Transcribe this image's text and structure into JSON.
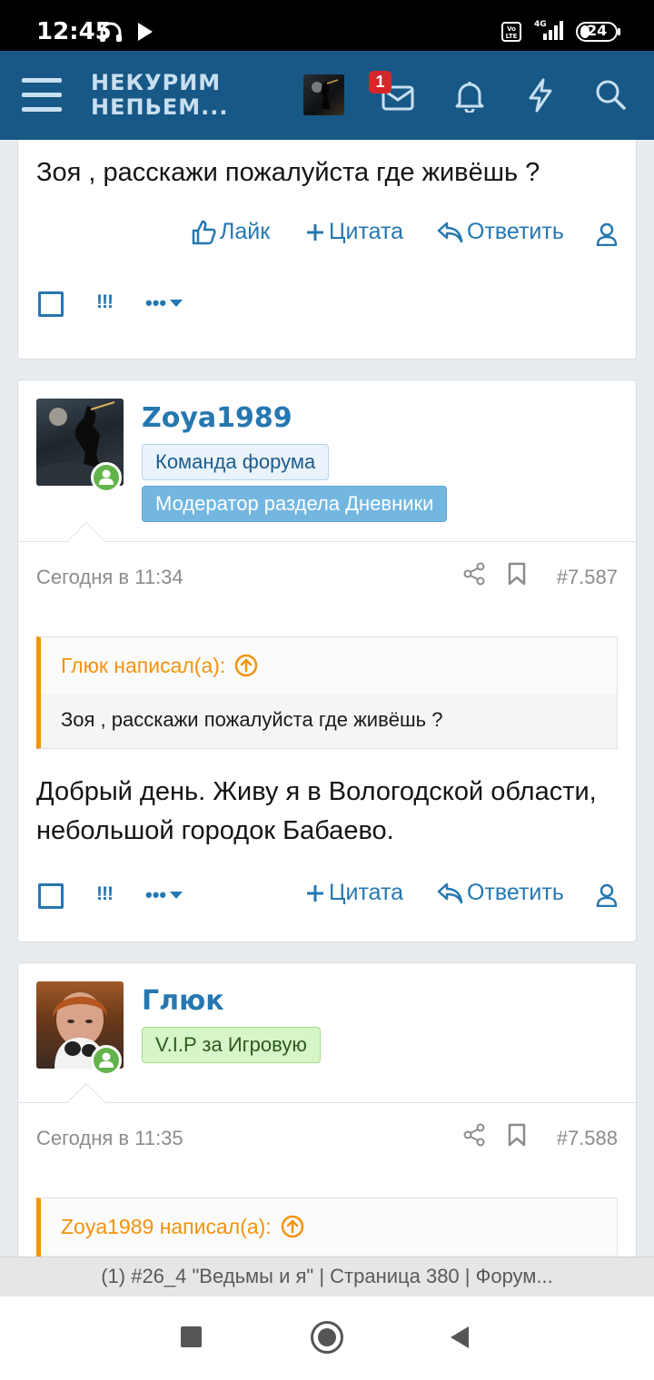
{
  "status_bar": {
    "time": "12:45",
    "battery": "24",
    "network": "4G"
  },
  "header": {
    "logo_line1": "НЕКУРИМ",
    "logo_line2": "НЕПЬЕМ...",
    "notification_count": "1"
  },
  "post_top": {
    "text": "Зоя , расскажи пожалуйста где живёшь ?",
    "like_label": "Лайк",
    "quote_label": "Цитата",
    "reply_label": "Ответить",
    "excl": "!!!"
  },
  "post_zoya": {
    "username": "Zoya1989",
    "tags": [
      "Команда форума",
      "Модератор раздела Дневники"
    ],
    "date": "Сегодня в 11:34",
    "number": "#7.587",
    "quote_author": "Глюк написал(а):",
    "quote_text": "Зоя , расскажи пожалуйста где живёшь ?",
    "text": "Добрый день. Живу я в Вологодской области, небольшой городок Бабаево.",
    "quote_label": "Цитата",
    "reply_label": "Ответить",
    "excl": "!!!"
  },
  "post_gluk": {
    "username": "Глюк",
    "tag": "V.I.P за Игровую",
    "date": "Сегодня в 11:35",
    "number": "#7.588",
    "quote_author": "Zoya1989 написал(а):"
  },
  "url_bar": {
    "text": "(1) #26_4 \"Ведьмы и я\" | Страница 380 | Форум..."
  },
  "colors": {
    "header": "#185886",
    "link": "#2577b1",
    "quote_accent": "#f2930d",
    "online": "#63b44a"
  }
}
